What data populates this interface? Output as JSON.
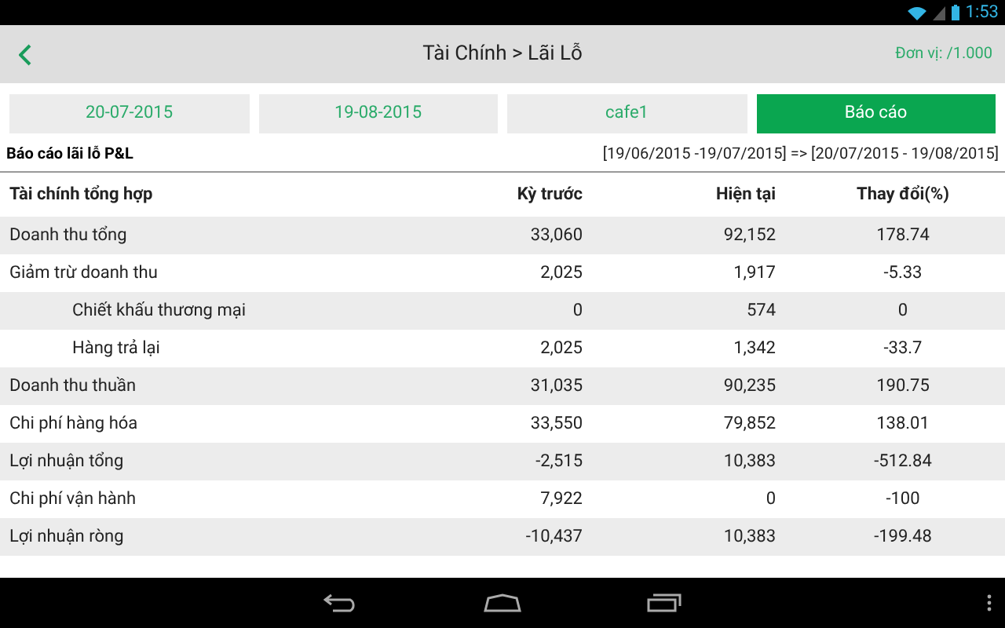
{
  "status_bar": {
    "time": "1:53"
  },
  "header": {
    "title": "Tài Chính > Lãi Lỗ",
    "unit": "Đơn vị: /1.000"
  },
  "filters": [
    {
      "kind": "field",
      "label": "20-07-2015"
    },
    {
      "kind": "field",
      "label": "19-08-2015"
    },
    {
      "kind": "field",
      "label": "cafe1"
    },
    {
      "kind": "primary",
      "label": "Báo cáo"
    }
  ],
  "report": {
    "title": "Báo cáo lãi lỗ P&L",
    "period": "[19/06/2015 -19/07/2015] => [20/07/2015 - 19/08/2015]"
  },
  "table": {
    "columns": [
      "Tài chính tổng hợp",
      "Kỳ trước",
      "Hiện tại",
      "Thay đổi(%)"
    ],
    "rows": [
      {
        "cells": [
          "Doanh thu tổng",
          "33,060",
          "92,152",
          "178.74"
        ]
      },
      {
        "cells": [
          "Giảm trừ doanh thu",
          "2,025",
          "1,917",
          "-5.33"
        ],
        "children": [
          {
            "cells": [
              "Chiết khấu thương mại",
              "0",
              "574",
              "0"
            ]
          },
          {
            "cells": [
              "Hàng trả lại",
              "2,025",
              "1,342",
              "-33.7"
            ]
          }
        ]
      },
      {
        "cells": [
          "Doanh thu thuần",
          "31,035",
          "90,235",
          "190.75"
        ]
      },
      {
        "cells": [
          "Chi phí hàng hóa",
          "33,550",
          "79,852",
          "138.01"
        ]
      },
      {
        "cells": [
          "Lợi nhuận tổng",
          "-2,515",
          "10,383",
          "-512.84"
        ]
      },
      {
        "cells": [
          "Chi phí vận hành",
          "7,922",
          "0",
          "-100"
        ]
      },
      {
        "cells": [
          "Lợi nhuận ròng",
          "-10,437",
          "10,383",
          "-199.48"
        ]
      }
    ]
  }
}
